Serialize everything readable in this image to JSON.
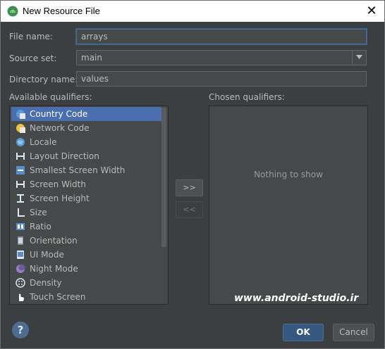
{
  "window": {
    "title": "New Resource File",
    "close_glyph": "✕"
  },
  "form": {
    "file_name_label": "File name:",
    "file_name_value": "arrays",
    "source_set_label": "Source set:",
    "source_set_value": "main",
    "directory_name_label": "Directory name:",
    "directory_name_value": "values"
  },
  "available": {
    "label": "Available qualifiers:",
    "items": [
      {
        "label": "Country Code",
        "icon": "country-code-icon",
        "selected": true
      },
      {
        "label": "Network Code",
        "icon": "network-code-icon"
      },
      {
        "label": "Locale",
        "icon": "globe-icon"
      },
      {
        "label": "Layout Direction",
        "icon": "layout-direction-icon"
      },
      {
        "label": "Smallest Screen Width",
        "icon": "smallest-screen-width-icon"
      },
      {
        "label": "Screen Width",
        "icon": "screen-width-icon"
      },
      {
        "label": "Screen Height",
        "icon": "screen-height-icon"
      },
      {
        "label": "Size",
        "icon": "size-icon"
      },
      {
        "label": "Ratio",
        "icon": "ratio-icon"
      },
      {
        "label": "Orientation",
        "icon": "orientation-icon"
      },
      {
        "label": "UI Mode",
        "icon": "ui-mode-icon"
      },
      {
        "label": "Night Mode",
        "icon": "night-mode-icon"
      },
      {
        "label": "Density",
        "icon": "density-icon"
      },
      {
        "label": "Touch Screen",
        "icon": "touch-screen-icon"
      }
    ]
  },
  "move": {
    "add_label": ">>",
    "remove_label": "<<"
  },
  "chosen": {
    "label": "Chosen qualifiers:",
    "empty_text": "Nothing to show"
  },
  "watermark": "www.android-studio.ir",
  "footer": {
    "help_glyph": "?",
    "ok_label": "OK",
    "cancel_label": "Cancel"
  },
  "colors": {
    "background": "#3c3f41",
    "selection": "#4b6eaf",
    "ok_button": "#365880"
  }
}
